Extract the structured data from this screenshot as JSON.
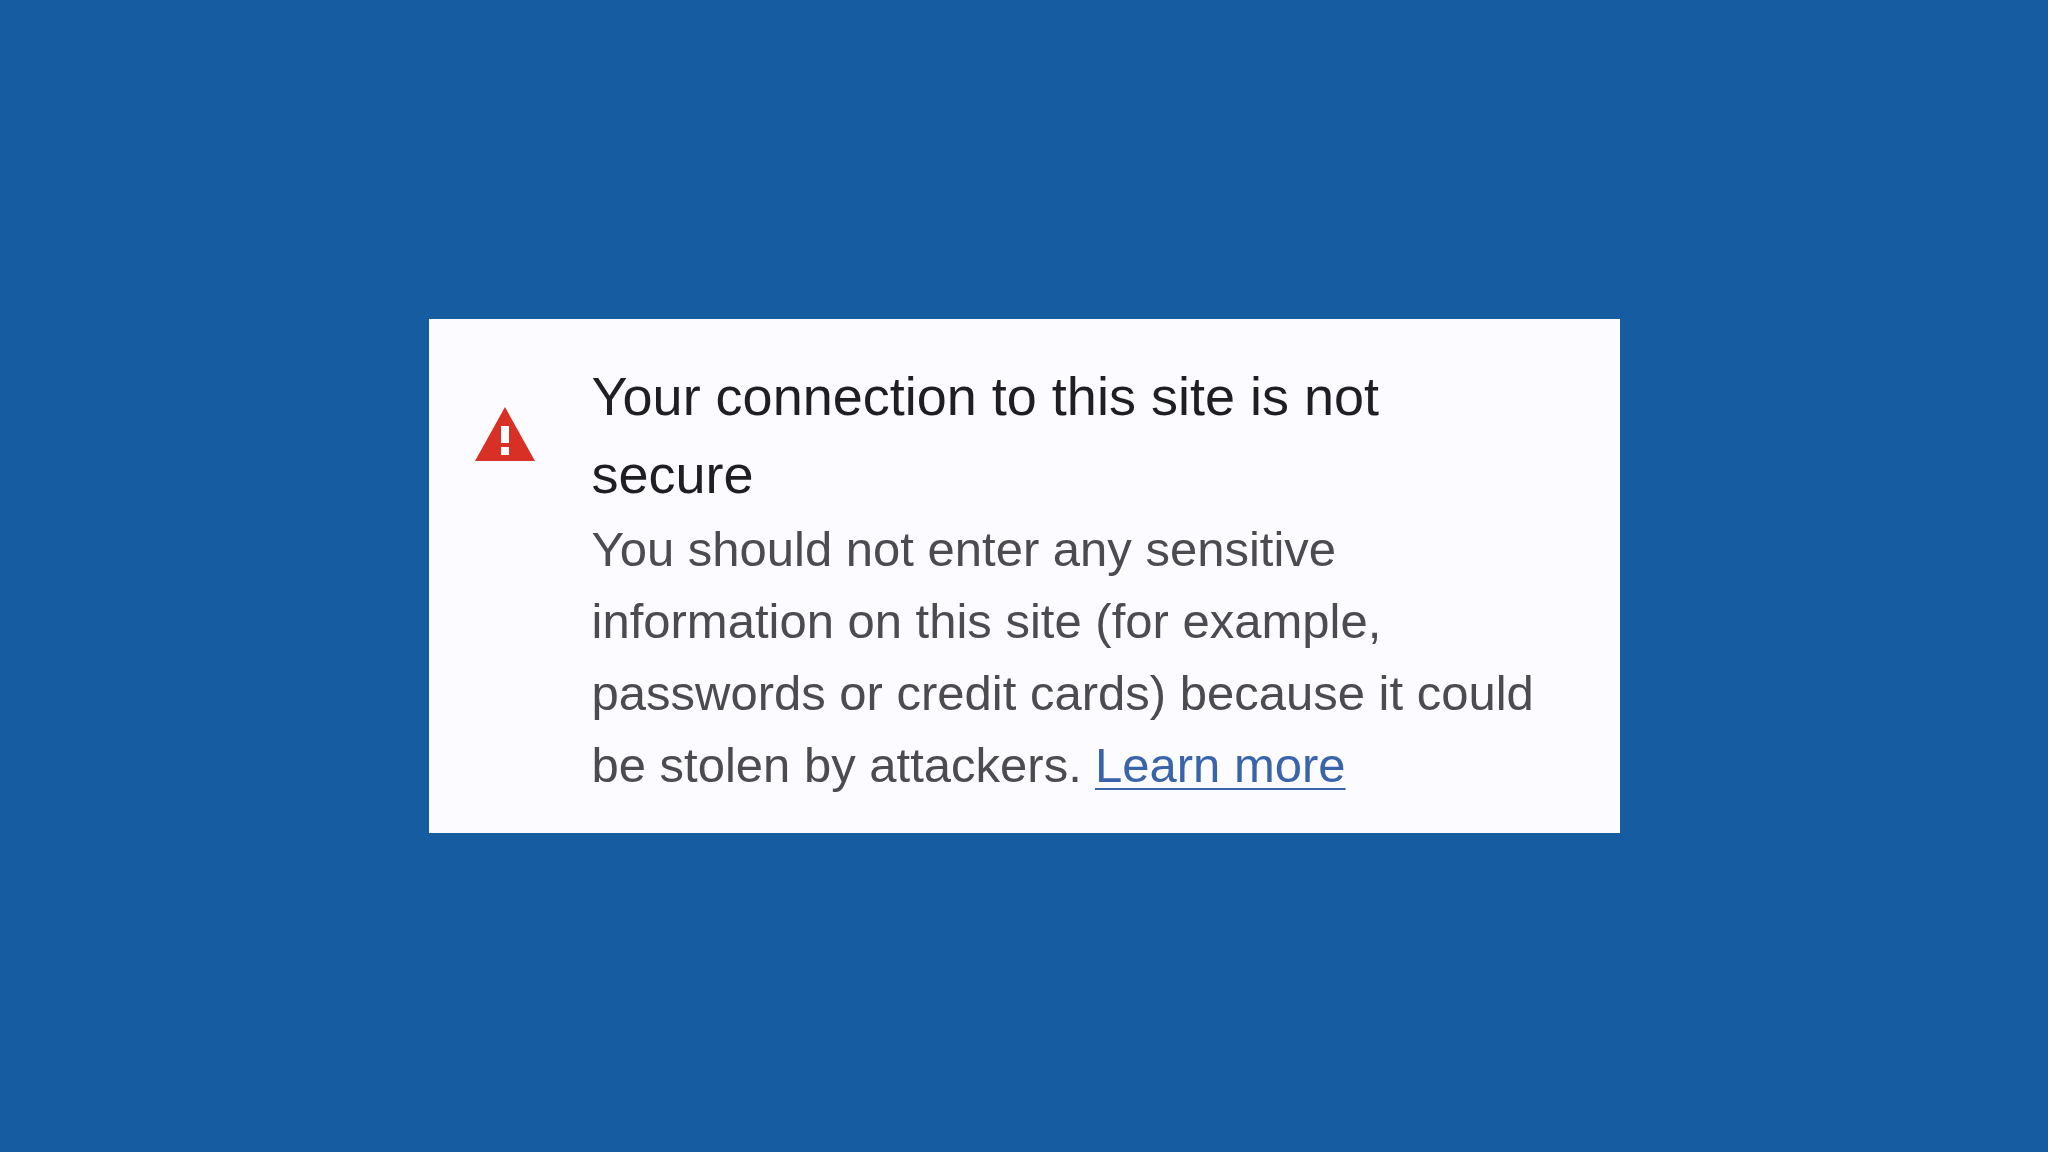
{
  "dialog": {
    "title": "Your connection to this site is not secure",
    "message": "You should not enter any sensitive information on this site (for example, passwords or credit cards) because it could be stolen by attackers.",
    "link": "Learn more"
  }
}
